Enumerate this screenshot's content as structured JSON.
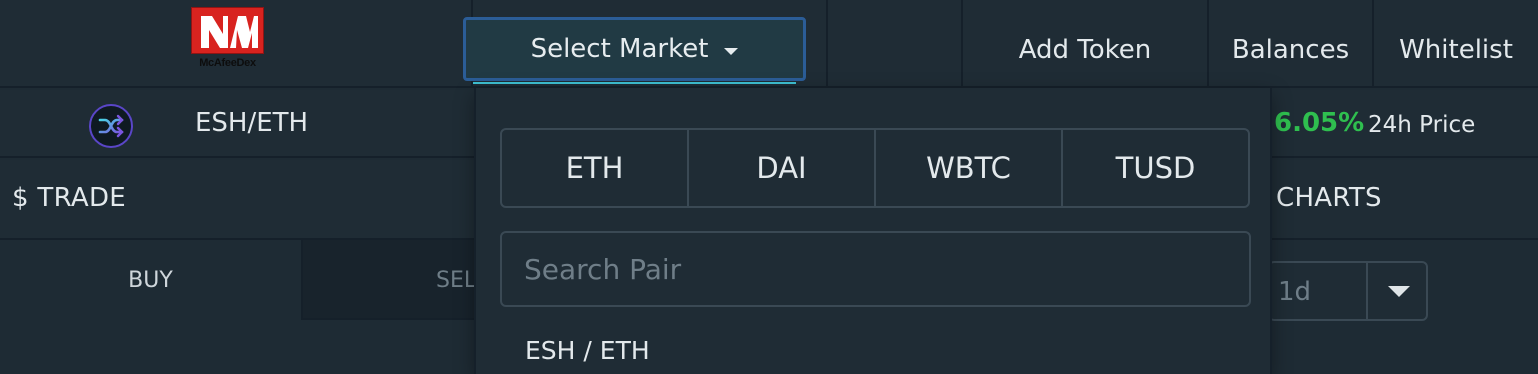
{
  "brand": {
    "logo_text": "McAfeeDex",
    "logo_color": "#d8231f"
  },
  "nav": {
    "select_market": "Select Market",
    "add_token": "Add Token",
    "balances": "Balances",
    "whitelist": "Whitelist"
  },
  "market": {
    "pair": "ESH/ETH",
    "change": "6.05%",
    "change_color": "#2fbf4f",
    "price_label": "24h Price"
  },
  "trade": {
    "title": "$ TRADE",
    "buy_label": "BUY",
    "sell_label": "SEL"
  },
  "charts": {
    "title": "CHARTS",
    "timeframe": "1d"
  },
  "market_dropdown": {
    "quote_tabs": [
      "ETH",
      "DAI",
      "WBTC",
      "TUSD"
    ],
    "search_placeholder": "Search Pair",
    "pairs": [
      "ESH / ETH"
    ]
  },
  "accent_colors": {
    "select_border": "#2b5d97",
    "underline": "#3ec0d2"
  }
}
